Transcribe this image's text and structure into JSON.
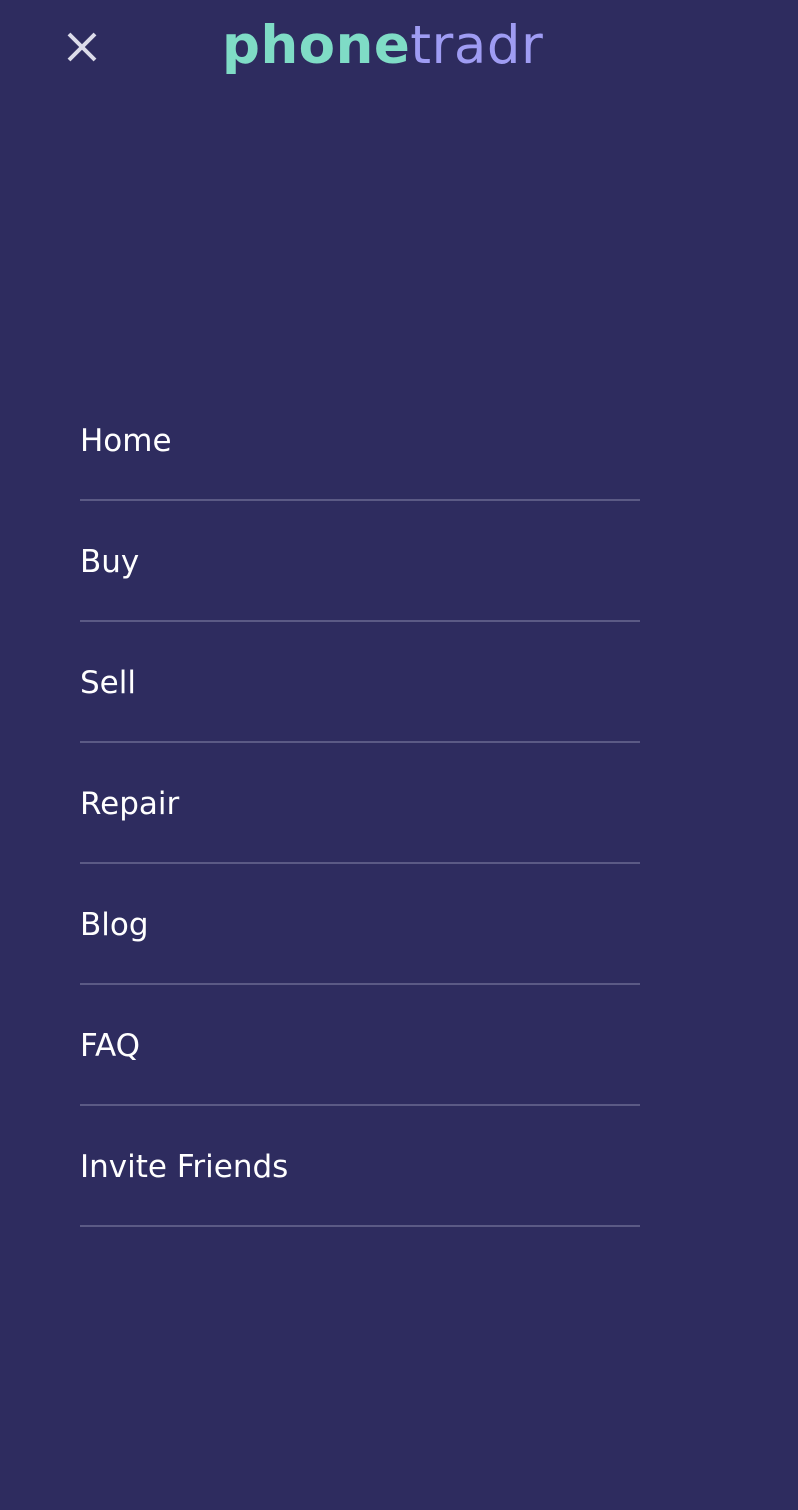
{
  "header": {
    "close_icon": "close-icon",
    "close_color": "#dcdcea",
    "logo": {
      "part_a": "phone",
      "part_b": "tradr",
      "part_a_color": "#7fdcc6",
      "part_b_color": "#9f9cf3"
    }
  },
  "background_color": "#2e2c5f",
  "menu": {
    "items": [
      {
        "label": "Home"
      },
      {
        "label": "Buy"
      },
      {
        "label": "Sell"
      },
      {
        "label": "Repair"
      },
      {
        "label": "Blog"
      },
      {
        "label": "FAQ"
      },
      {
        "label": "Invite Friends"
      }
    ]
  }
}
